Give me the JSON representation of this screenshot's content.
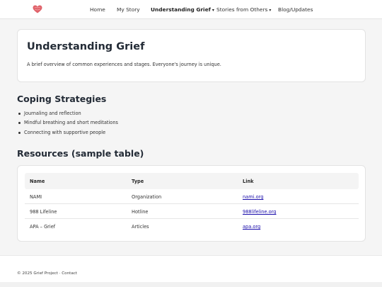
{
  "nav": {
    "logo_icon": "heart-icon",
    "accent": "#e0636b",
    "items": [
      {
        "label": "Home"
      },
      {
        "label": "My Story"
      },
      {
        "label": "Understanding Grief",
        "caret": "▾"
      },
      {
        "label": "Stories from Others",
        "caret": "▾"
      },
      {
        "label": "Blog/Updates"
      }
    ]
  },
  "hero": {
    "title": "Understanding Grief",
    "subtitle": "A brief overview of common experiences and stages. Everyone's journey is unique."
  },
  "coping": {
    "heading": "Coping Strategies",
    "items": [
      "Journaling and reflection",
      "Mindful breathing and short meditations",
      "Connecting with supportive people"
    ]
  },
  "resources": {
    "heading": "Resources (sample table)",
    "columns": [
      "Name",
      "Type",
      "Link"
    ],
    "rows": [
      {
        "name": "NAMI",
        "type": "Organization",
        "link": "nami.org"
      },
      {
        "name": "988 Lifeline",
        "type": "Hotline",
        "link": "988lifeline.org"
      },
      {
        "name": "APA – Grief",
        "type": "Articles",
        "link": "apa.org"
      }
    ]
  },
  "footer": {
    "text": "© 2025 Grief Project · ",
    "contact": "Contact"
  }
}
